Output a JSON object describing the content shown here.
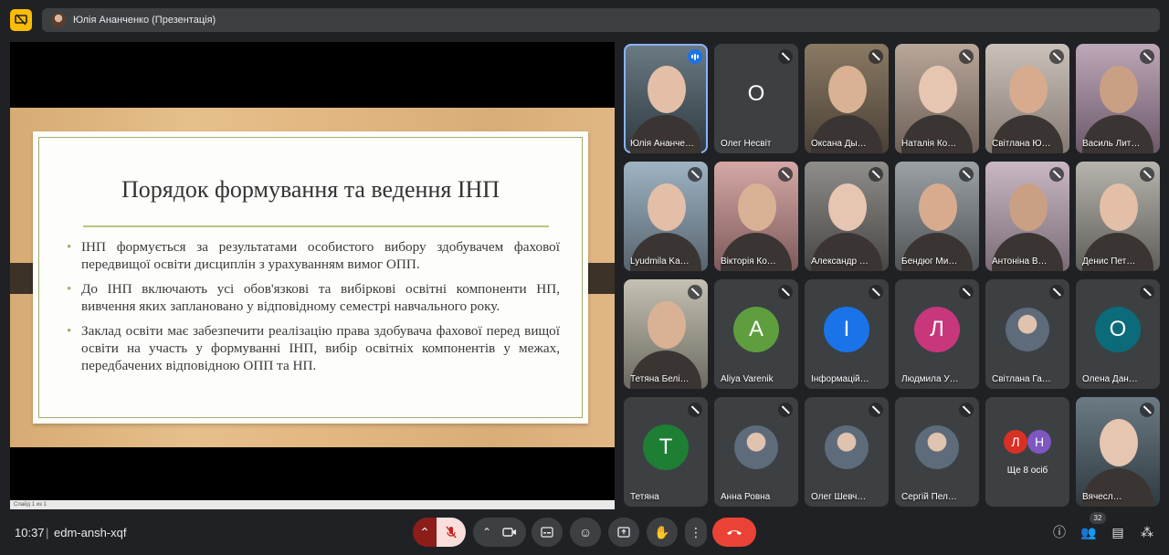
{
  "header": {
    "presenter_title": "Юлія Ананченко (Презентація)"
  },
  "slide": {
    "title": "Порядок формування та ведення ІНП",
    "bullets": [
      "ІНП формується за результатами особистого вибору здобувачем фахової передвищої освіти дисциплін з урахуванням вимог ОПП.",
      "До ІНП включають усі обов'язкові та вибіркові освітні компоненти НП, вивчення яких заплановано у відповідному семестрі навчального року.",
      "Заклад освіти має забезпечити реалізацію права здобувача фахової перед вищої освіти на участь у формуванні ІНП, вибір освітніх компонентів у межах, передбачених відповідною ОПП та НП."
    ],
    "status": "Слайд 1 из 1"
  },
  "participants": [
    {
      "name": "Юлія Ананче…",
      "type": "video",
      "speaking": true
    },
    {
      "name": "Олег Несвіт",
      "type": "letter",
      "letter": "О",
      "color": "#3c4043"
    },
    {
      "name": "Оксана Ды…",
      "type": "video"
    },
    {
      "name": "Наталія Ко…",
      "type": "video"
    },
    {
      "name": "Світлана Ю…",
      "type": "video"
    },
    {
      "name": "Василь Лит…",
      "type": "video"
    },
    {
      "name": "Lyudmila Ka…",
      "type": "video"
    },
    {
      "name": "Вікторія Ко…",
      "type": "video"
    },
    {
      "name": "Александр …",
      "type": "video"
    },
    {
      "name": "Бендюг Ми…",
      "type": "video"
    },
    {
      "name": "Антоніна В…",
      "type": "video"
    },
    {
      "name": "Денис Пет…",
      "type": "video"
    },
    {
      "name": "Тетяна Белі…",
      "type": "video"
    },
    {
      "name": "Aliya Varenik",
      "type": "letter",
      "letter": "A",
      "color": "#5e9e3e"
    },
    {
      "name": "Інформацій…",
      "type": "letter",
      "letter": "І",
      "color": "#1a73e8"
    },
    {
      "name": "Людмила У…",
      "type": "letter",
      "letter": "Л",
      "color": "#c8367c"
    },
    {
      "name": "Світлана Га…",
      "type": "avatar"
    },
    {
      "name": "Олена Дан…",
      "type": "letter",
      "letter": "О",
      "color": "#0b6b7a"
    },
    {
      "name": "Тетяна",
      "type": "letter",
      "letter": "Т",
      "color": "#1e7e34"
    },
    {
      "name": "Анна Ровна",
      "type": "avatar"
    },
    {
      "name": "Олег Шевч…",
      "type": "avatar"
    },
    {
      "name": "Сергій Пел…",
      "type": "avatar"
    },
    {
      "name": "Ще 8 осіб",
      "type": "more",
      "letters": [
        "Л",
        "Н"
      ]
    },
    {
      "name": "Вячесл…",
      "type": "video"
    }
  ],
  "bottom": {
    "time": "10:37",
    "separator": "|",
    "meeting_code": "edm-ansh-xqf",
    "participants_count": "32"
  }
}
